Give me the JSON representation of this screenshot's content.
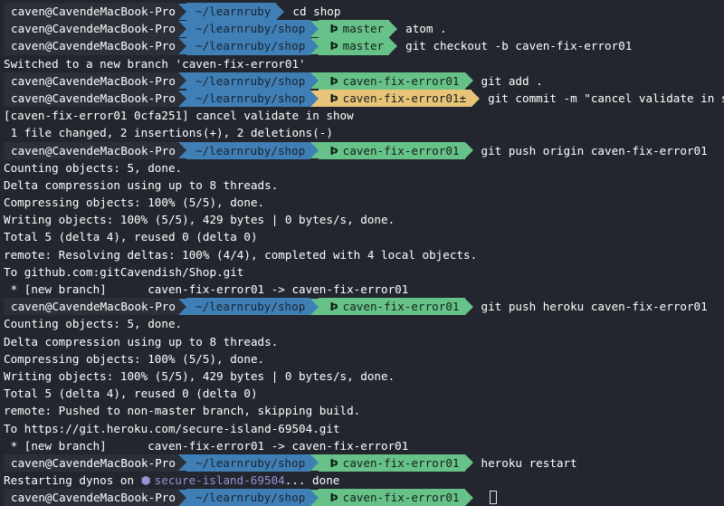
{
  "colors": {
    "background": "#23262e",
    "user_segment": "#2b2f38",
    "path_segment": "#3f7fb5",
    "branch_clean": "#67c289",
    "branch_dirty": "#e8c378",
    "heroku_app": "#9d8fd6"
  },
  "icons": {
    "branch": "git-branch-icon",
    "heroku": "hexagon-icon",
    "cursor": "block-cursor"
  },
  "lines": [
    {
      "type": "prompt",
      "user": "caven@CavendeMacBook-Pro",
      "path": "~/learnruby",
      "branch": "",
      "state": "none",
      "command": "cd shop"
    },
    {
      "type": "prompt",
      "user": "caven@CavendeMacBook-Pro",
      "path": "~/learnruby/shop",
      "branch": "master",
      "state": "clean",
      "command": "atom ."
    },
    {
      "type": "prompt",
      "user": "caven@CavendeMacBook-Pro",
      "path": "~/learnruby/shop",
      "branch": "master",
      "state": "clean",
      "command": "git checkout -b caven-fix-error01"
    },
    {
      "type": "output",
      "text": "Switched to a new branch 'caven-fix-error01'"
    },
    {
      "type": "prompt",
      "user": "caven@CavendeMacBook-Pro",
      "path": "~/learnruby/shop",
      "branch": "caven-fix-error01",
      "state": "clean",
      "command": "git add ."
    },
    {
      "type": "prompt",
      "user": "caven@CavendeMacBook-Pro",
      "path": "~/learnruby/shop",
      "branch": "caven-fix-error01±",
      "state": "dirty",
      "command": "git commit -m \"cancel validate in show\""
    },
    {
      "type": "output",
      "text": "[caven-fix-error01 0cfa251] cancel validate in show"
    },
    {
      "type": "output",
      "text": " 1 file changed, 2 insertions(+), 2 deletions(-)"
    },
    {
      "type": "prompt",
      "user": "caven@CavendeMacBook-Pro",
      "path": "~/learnruby/shop",
      "branch": "caven-fix-error01",
      "state": "clean",
      "command": "git push origin caven-fix-error01"
    },
    {
      "type": "output",
      "text": "Counting objects: 5, done."
    },
    {
      "type": "output",
      "text": "Delta compression using up to 8 threads."
    },
    {
      "type": "output",
      "text": "Compressing objects: 100% (5/5), done."
    },
    {
      "type": "output",
      "text": "Writing objects: 100% (5/5), 429 bytes | 0 bytes/s, done."
    },
    {
      "type": "output",
      "text": "Total 5 (delta 4), reused 0 (delta 0)"
    },
    {
      "type": "output",
      "text": "remote: Resolving deltas: 100% (4/4), completed with 4 local objects."
    },
    {
      "type": "output",
      "text": "To github.com:gitCavendish/Shop.git"
    },
    {
      "type": "output",
      "text": " * [new branch]      caven-fix-error01 -> caven-fix-error01"
    },
    {
      "type": "prompt",
      "user": "caven@CavendeMacBook-Pro",
      "path": "~/learnruby/shop",
      "branch": "caven-fix-error01",
      "state": "clean",
      "command": "git push heroku caven-fix-error01"
    },
    {
      "type": "output",
      "text": "Counting objects: 5, done."
    },
    {
      "type": "output",
      "text": "Delta compression using up to 8 threads."
    },
    {
      "type": "output",
      "text": "Compressing objects: 100% (5/5), done."
    },
    {
      "type": "output",
      "text": "Writing objects: 100% (5/5), 429 bytes | 0 bytes/s, done."
    },
    {
      "type": "output",
      "text": "Total 5 (delta 4), reused 0 (delta 0)"
    },
    {
      "type": "output",
      "text": "remote: Pushed to non-master branch, skipping build."
    },
    {
      "type": "output",
      "text": "To https://git.heroku.com/secure-island-69504.git"
    },
    {
      "type": "output",
      "text": " * [new branch]      caven-fix-error01 -> caven-fix-error01"
    },
    {
      "type": "prompt",
      "user": "caven@CavendeMacBook-Pro",
      "path": "~/learnruby/shop",
      "branch": "caven-fix-error01",
      "state": "clean",
      "command": "heroku restart"
    },
    {
      "type": "heroku",
      "prefix": "Restarting dynos on ",
      "app": "secure-island-69504",
      "suffix": "... done"
    },
    {
      "type": "prompt",
      "user": "caven@CavendeMacBook-Pro",
      "path": "~/learnruby/shop",
      "branch": "caven-fix-error01",
      "state": "clean",
      "command": "",
      "cursor": true
    }
  ]
}
